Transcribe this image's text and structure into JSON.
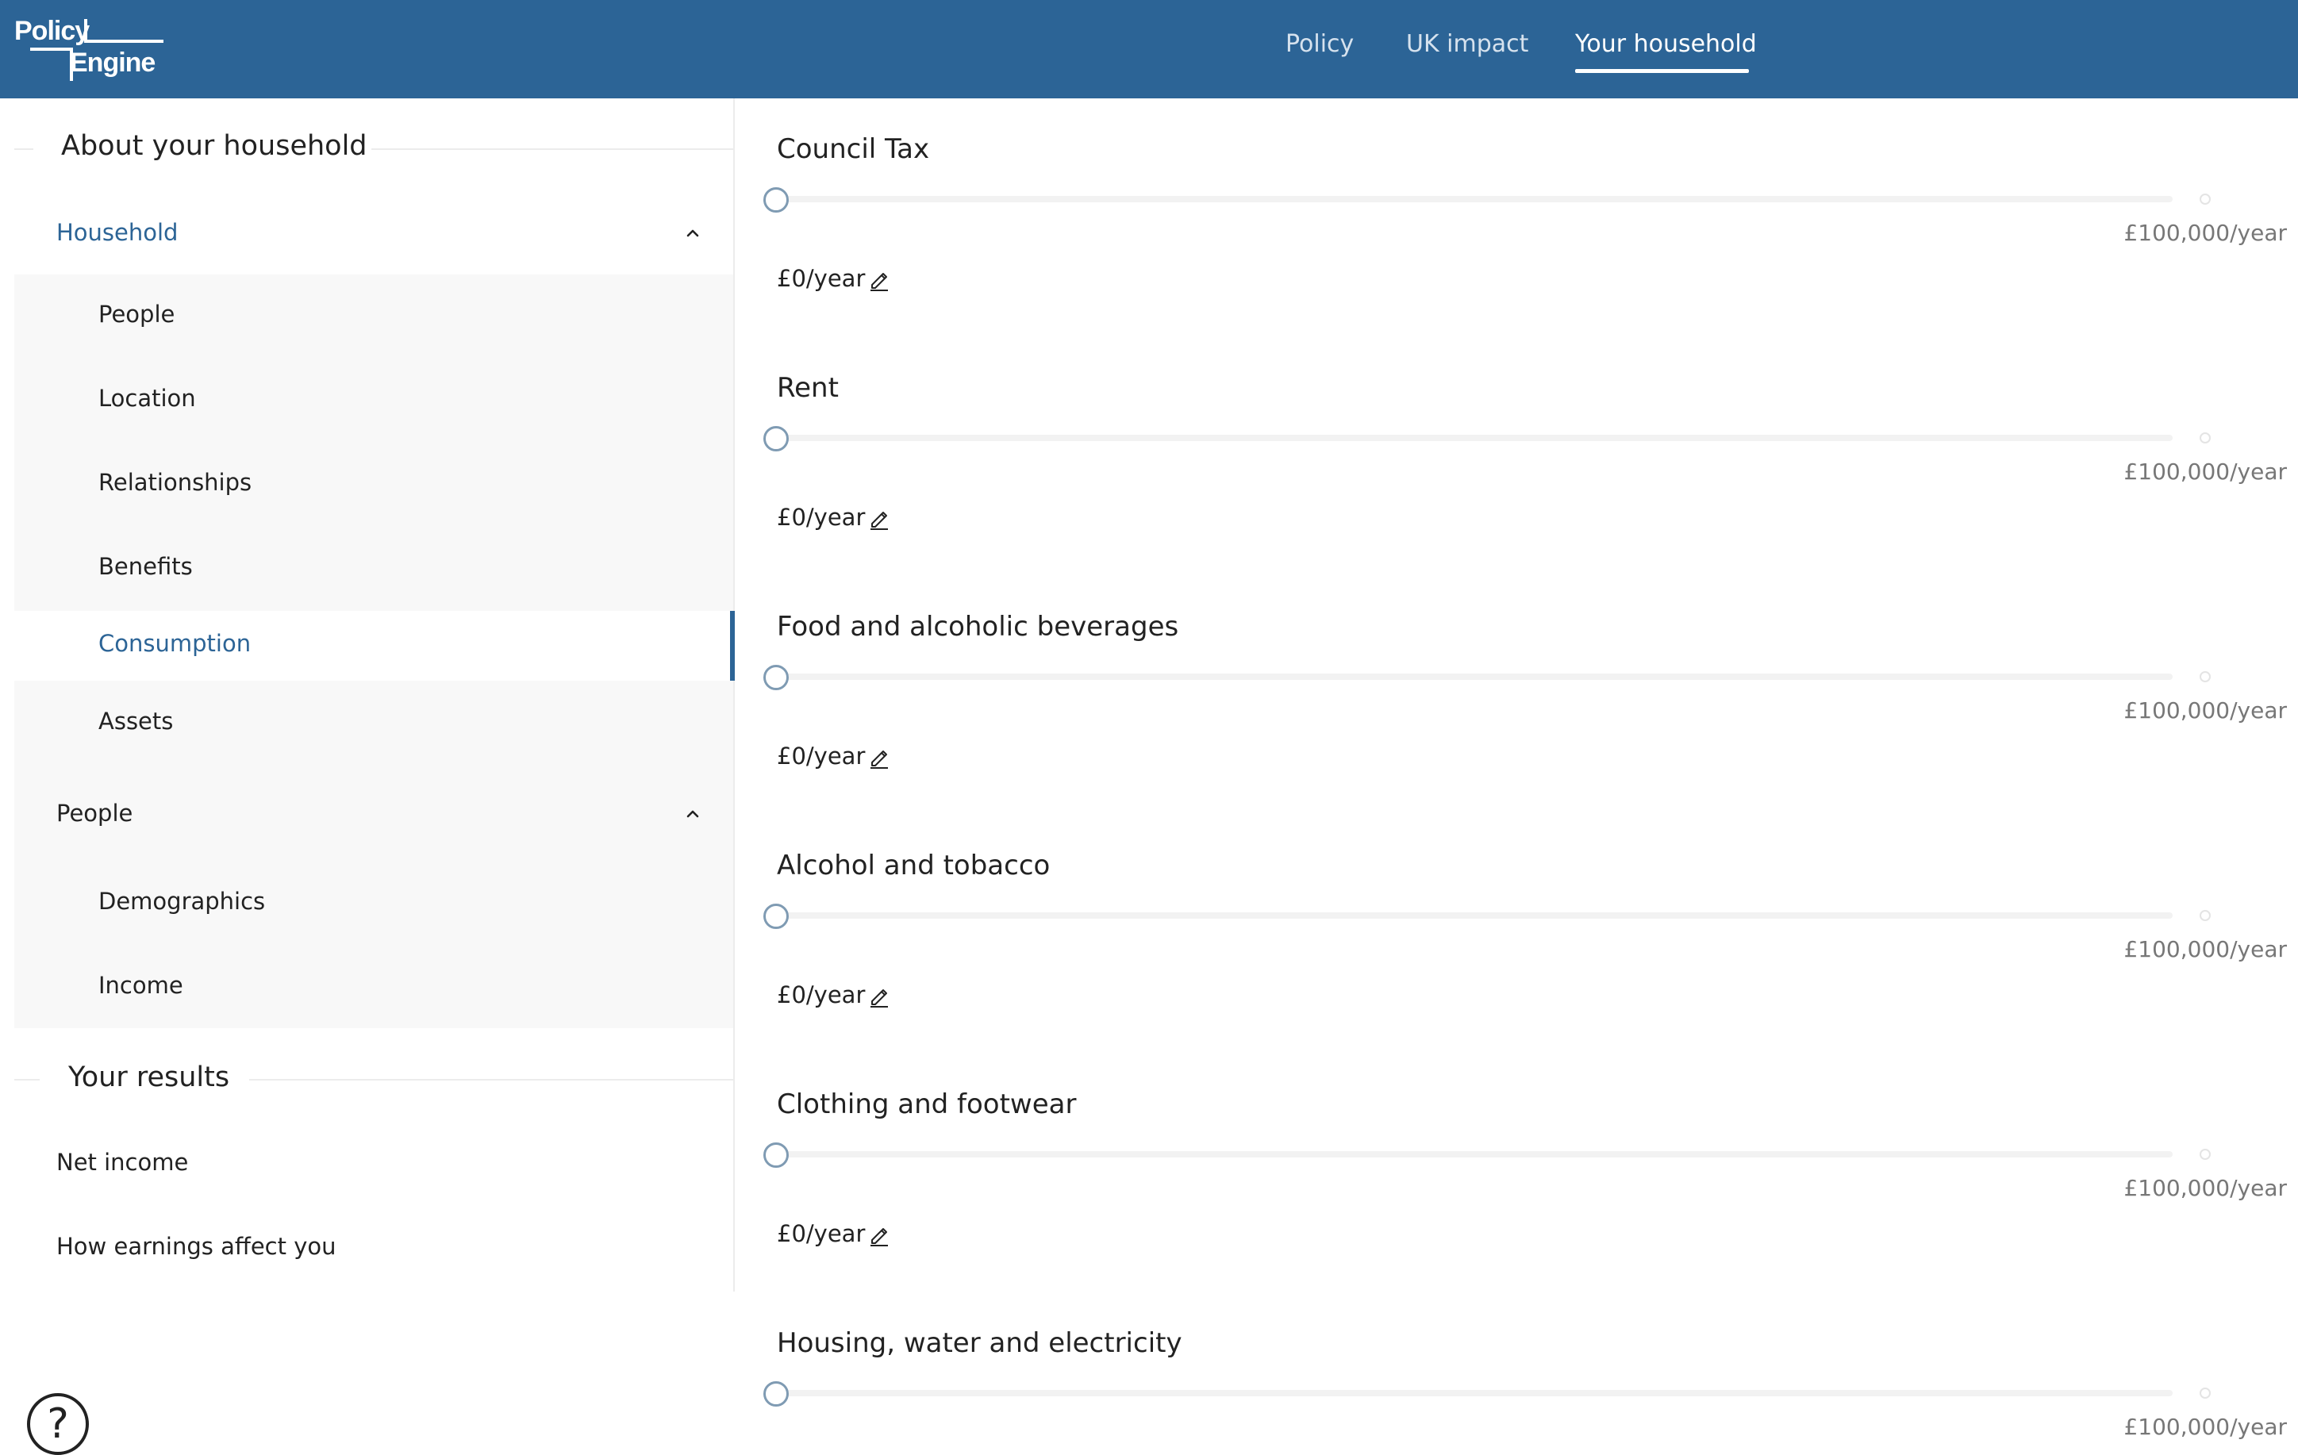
{
  "header": {
    "logo": {
      "line1": "Policy",
      "line2": "Engine"
    },
    "nav": [
      {
        "label": "Policy"
      },
      {
        "label": "UK impact"
      },
      {
        "label": "Your household",
        "active": true
      }
    ]
  },
  "sidebar": {
    "about_title": "About your household",
    "groups": [
      {
        "label": "Household",
        "expanded": true,
        "items": [
          {
            "label": "People"
          },
          {
            "label": "Location"
          },
          {
            "label": "Relationships"
          },
          {
            "label": "Benefits"
          },
          {
            "label": "Consumption",
            "active": true
          },
          {
            "label": "Assets"
          }
        ]
      },
      {
        "label": "People",
        "expanded": true,
        "items": [
          {
            "label": "Demographics"
          },
          {
            "label": "Income"
          }
        ]
      }
    ],
    "results_title": "Your results",
    "results": [
      {
        "label": "Net income"
      },
      {
        "label": "How earnings affect you"
      }
    ],
    "help_symbol": "?"
  },
  "main": {
    "fields": [
      {
        "title": "Council Tax",
        "value": "£0/year",
        "max": "£100,000/year",
        "slider_value": 0
      },
      {
        "title": "Rent",
        "value": "£0/year",
        "max": "£100,000/year",
        "slider_value": 0
      },
      {
        "title": "Food and alcoholic beverages",
        "value": "£0/year",
        "max": "£100,000/year",
        "slider_value": 0
      },
      {
        "title": "Alcohol and tobacco",
        "value": "£0/year",
        "max": "£100,000/year",
        "slider_value": 0
      },
      {
        "title": "Clothing and footwear",
        "value": "£0/year",
        "max": "£100,000/year",
        "slider_value": 0
      },
      {
        "title": "Housing, water and electricity",
        "value": "",
        "max": "£100,000/year",
        "slider_value": 0
      }
    ]
  },
  "colors": {
    "header_bg": "#2c6496",
    "accent": "#2c6496",
    "slider_thumb": "#7f9bb3"
  },
  "icons": {
    "edit": "pencil-icon",
    "chevron": "chevron-up-icon",
    "help": "help-circle-icon"
  }
}
